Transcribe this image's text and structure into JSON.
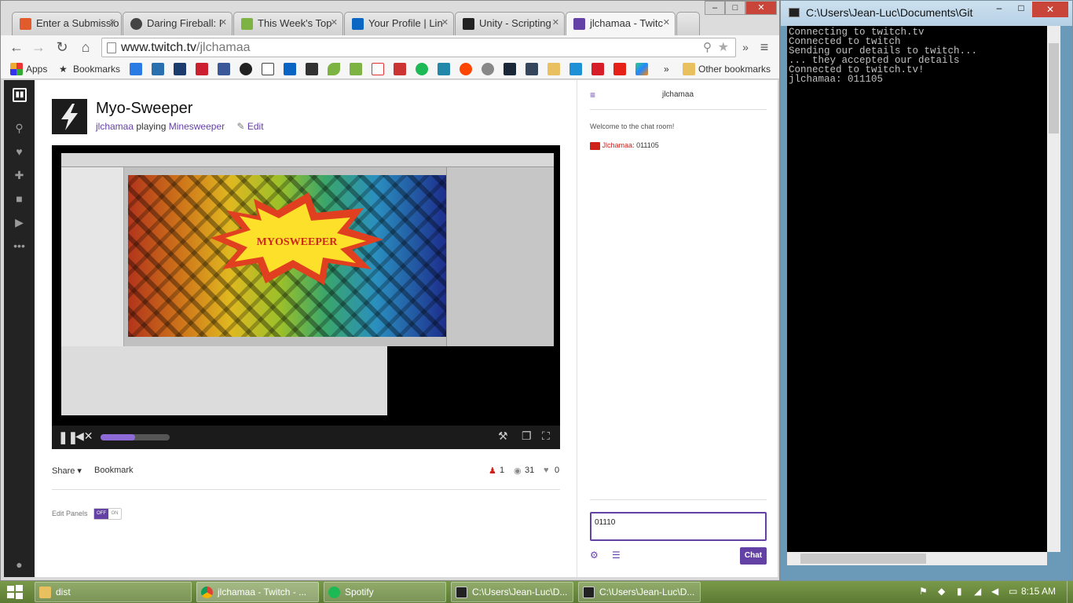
{
  "browser": {
    "tabs": [
      {
        "label": "Enter a Submissio"
      },
      {
        "label": "Daring Fireball: I"
      },
      {
        "label": "This Week's Top"
      },
      {
        "label": "Your Profile | Lin"
      },
      {
        "label": "Unity - Scripting"
      },
      {
        "label": "jlchamaa - Twitc"
      }
    ],
    "url_host": "www.twitch.tv",
    "url_path": "/jlchamaa",
    "window_controls": {
      "minimize": "–",
      "maximize": "□",
      "close": "✕"
    },
    "bookmarks": {
      "apps_label": "Apps",
      "bookmarks_label": "Bookmarks",
      "overflow": "»",
      "other_label": "Other bookmarks",
      "icons": [
        "dropbox-icon",
        "ucla-icon",
        "d-icon",
        "espn-icon",
        "facebook-icon",
        "github-icon",
        "h-icon",
        "linkedin-icon",
        "ifl-icon",
        "leaf-icon",
        "lh-icon",
        "gmail-icon",
        "nba-icon",
        "spotify-icon",
        "p-icon",
        "reddit-alien-icon",
        "reddit-icon",
        "steam-icon",
        "tumblr-icon",
        "folder-icon",
        "v-icon",
        "wf-icon",
        "youtube-icon",
        "play-icon"
      ]
    }
  },
  "twitch": {
    "stream_title": "Myo-Sweeper",
    "channel": "jlchamaa",
    "playing_word": "playing",
    "game": "Minesweeper",
    "edit_label": "Edit",
    "video_banner": "MYOSWEEPER",
    "player": {
      "volume_level": 0.5
    },
    "actions": {
      "share": "Share",
      "bookmark": "Bookmark"
    },
    "stats": {
      "viewers": "1",
      "views": "31",
      "followers": "0"
    },
    "edit_panels": {
      "label": "Edit Panels",
      "off": "OFF",
      "on": "ON"
    }
  },
  "chat": {
    "header": "jlchamaa",
    "welcome": "Welcome to the chat room!",
    "messages": [
      {
        "user": "Jlchamaa",
        "text": "011105"
      }
    ],
    "input_value": "01110",
    "send_label": "Chat"
  },
  "console": {
    "title": "C:\\Users\\Jean-Luc\\Documents\\Git",
    "lines": [
      "Connecting to twitch.tv",
      "Connected to twitch",
      "Sending our details to twitch...",
      "... they accepted our details",
      "Connected to twitch.tv!",
      "jlchamaa: 011105"
    ]
  },
  "taskbar": {
    "items": [
      {
        "label": "dist"
      },
      {
        "label": "jlchamaa - Twitch - ..."
      },
      {
        "label": "Spotify"
      },
      {
        "label": "C:\\Users\\Jean-Luc\\D..."
      },
      {
        "label": "C:\\Users\\Jean-Luc\\D..."
      }
    ],
    "clock": "8:15 AM"
  },
  "colors": {
    "twitch_purple": "#6441a5",
    "nav_dark": "#232323",
    "console_bg": "#000000"
  }
}
